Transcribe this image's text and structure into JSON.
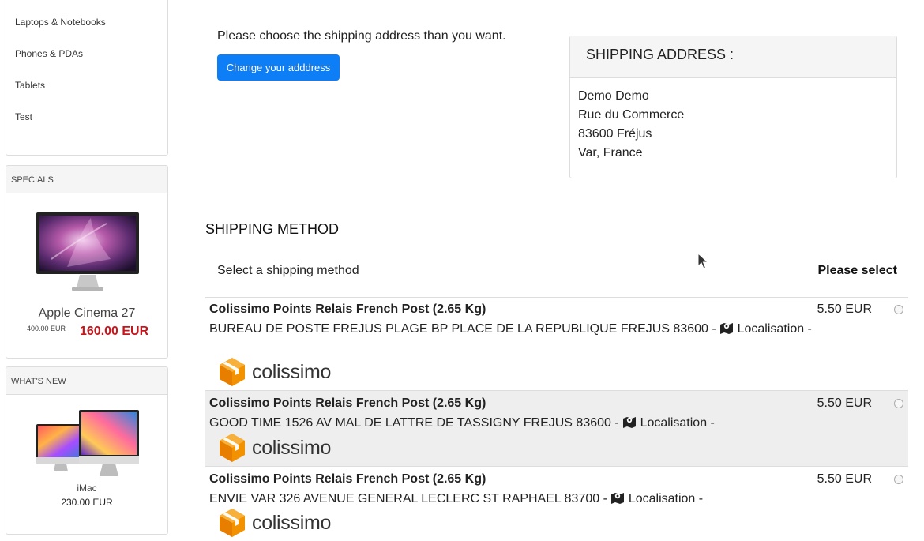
{
  "categories": [
    "Laptops & Notebooks",
    "Phones & PDAs",
    "Tablets",
    "Test"
  ],
  "specials": {
    "heading": "SPECIALS",
    "product_name": "Apple Cinema 27",
    "old_price": "400.00 EUR",
    "new_price": "160.00 EUR"
  },
  "whats_new": {
    "heading": "WHAT'S NEW",
    "product_name": "iMac",
    "price": "230.00 EUR"
  },
  "shipping_address": {
    "intro": "Please choose the shipping address than you want.",
    "change_button": "Change your adddress",
    "title": "SHIPPING ADDRESS :",
    "lines": [
      "Demo Demo",
      "Rue du Commerce",
      "83600 Fréjus",
      "Var, France"
    ]
  },
  "shipping_method": {
    "title": "SHIPPING METHOD",
    "select_label": "Select a shipping method",
    "please_select": "Please select",
    "options": [
      {
        "title": "Colissimo Points Relais French Post (2.65 Kg)",
        "address": "BUREAU DE POSTE FREJUS PLAGE BP PLACE DE LA REPUBLIQUE FREJUS 83600 -",
        "localisation": "Localisation -",
        "price": "5.50 EUR",
        "logo_text": "colissimo"
      },
      {
        "title": "Colissimo Points Relais French Post (2.65 Kg)",
        "address": "GOOD TIME 1526 AV MAL DE LATTRE DE TASSIGNY FREJUS 83600 -",
        "localisation": "Localisation -",
        "price": "5.50 EUR",
        "logo_text": "colissimo"
      },
      {
        "title": "Colissimo Points Relais French Post (2.65 Kg)",
        "address": "ENVIE VAR 326 AVENUE GENERAL LECLERC ST RAPHAEL 83700 -",
        "localisation": "Localisation -",
        "price": "5.50 EUR",
        "logo_text": "colissimo"
      }
    ]
  },
  "colors": {
    "primary_button": "#0d7ef5",
    "sale_price": "#c4161c",
    "colissimo_orange": "#f39200",
    "selected_row": "#eeeeee"
  },
  "icons": [
    "map-icon",
    "colissimo-logo-icon",
    "mouse-cursor-icon"
  ]
}
